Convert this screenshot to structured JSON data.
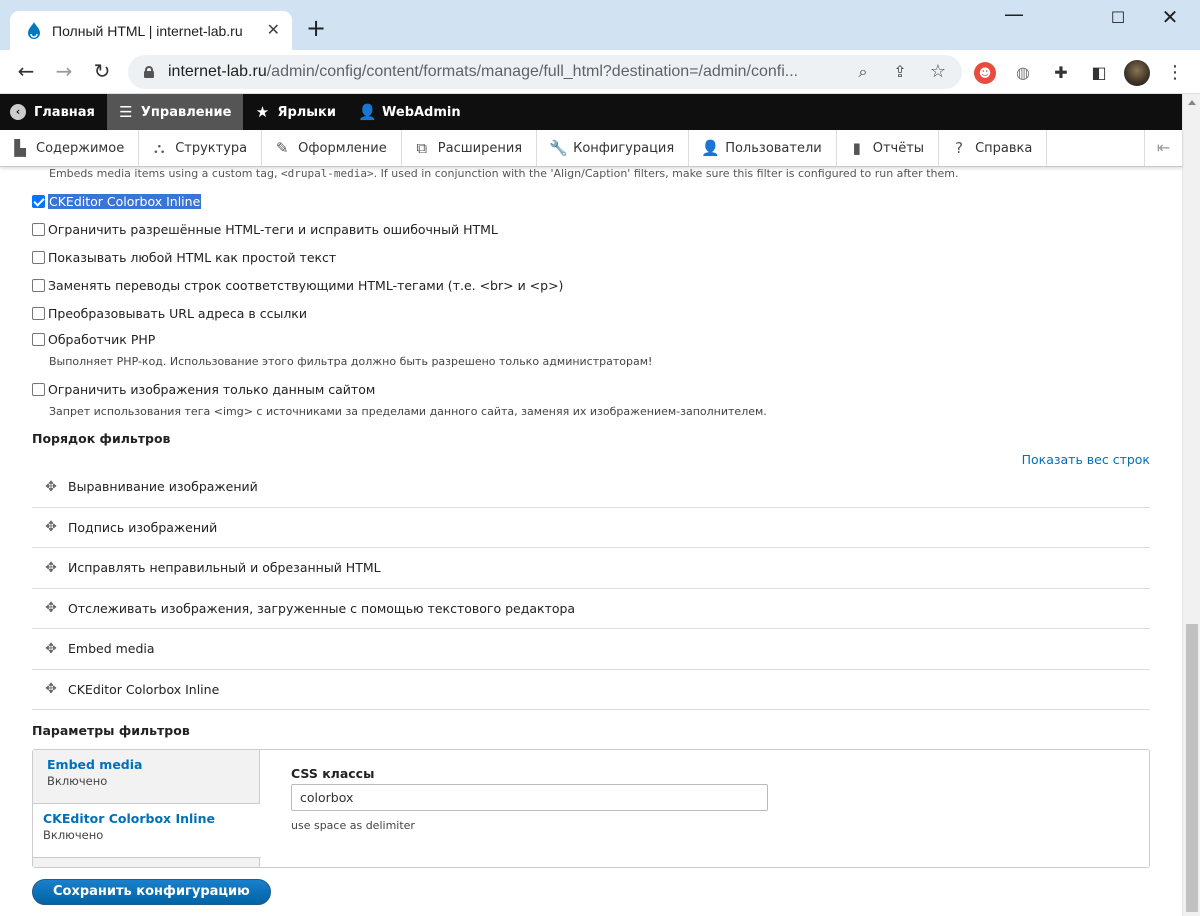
{
  "browser": {
    "tab_title": "Полный HTML | internet-lab.ru",
    "url_host": "internet-lab.ru",
    "url_path": "/admin/config/content/formats/manage/full_html?destination=/admin/confi...",
    "new_tab_glyph": "+",
    "close_glyph": "✕"
  },
  "drupal_toolbar": {
    "items": [
      {
        "label": "Главная",
        "icon": "drupal-home-icon"
      },
      {
        "label": "Управление",
        "icon": "menu-icon",
        "active": true
      },
      {
        "label": "Ярлыки",
        "icon": "star-icon"
      },
      {
        "label": "WebAdmin",
        "icon": "user-icon"
      }
    ]
  },
  "admin_tray": {
    "items": [
      {
        "label": "Содержимое",
        "icon": "content-icon"
      },
      {
        "label": "Структура",
        "icon": "structure-icon"
      },
      {
        "label": "Оформление",
        "icon": "appearance-icon"
      },
      {
        "label": "Расширения",
        "icon": "extend-icon"
      },
      {
        "label": "Конфигурация",
        "icon": "wrench-icon"
      },
      {
        "label": "Пользователи",
        "icon": "people-icon"
      },
      {
        "label": "Отчёты",
        "icon": "reports-icon"
      },
      {
        "label": "Справка",
        "icon": "help-icon"
      }
    ]
  },
  "filters": {
    "cut_description_prefix": "Embeds media items using a custom tag, ",
    "cut_description_code": "<drupal-media>",
    "cut_description_suffix": ". If used in conjunction with the 'Align/Caption' filters, make sure this filter is configured to run after them.",
    "items": [
      {
        "label": "CKEditor Colorbox Inline",
        "checked": true
      },
      {
        "label": "Ограничить разрешённые HTML-теги и исправить ошибочный HTML",
        "checked": false
      },
      {
        "label": "Показывать любой HTML как простой текст",
        "checked": false
      },
      {
        "label": "Заменять переводы строк соответствующими HTML-тегами (т.е. <br> и <p>)",
        "checked": false
      },
      {
        "label": "Преобразовывать URL адреса в ссылки",
        "checked": false
      },
      {
        "label": "Обработчик PHP",
        "checked": false,
        "description": "Выполняет PHP-код. Использование этого фильтра должно быть разрешено только администраторам!"
      },
      {
        "label": "Ограничить изображения только данным сайтом",
        "checked": false,
        "description": "Запрет использования тега <img> с источниками за пределами данного сайта, заменяя их изображением-заполнителем."
      }
    ]
  },
  "filter_order": {
    "title": "Порядок фильтров",
    "show_weights": "Показать вес строк",
    "rows": [
      "Выравнивание изображений",
      "Подпись изображений",
      "Исправлять неправильный и обрезанный HTML",
      "Отслеживать изображения, загруженные с помощью текстового редактора",
      "Embed media",
      "CKEditor Colorbox Inline"
    ]
  },
  "filter_settings": {
    "title": "Параметры фильтров",
    "tabs": [
      {
        "title": "Embed media",
        "summary": "Включено"
      },
      {
        "title": "CKEditor Colorbox Inline",
        "summary": "Включено"
      }
    ],
    "field_label": "CSS классы",
    "field_value": "colorbox",
    "field_description": "use space as delimiter"
  },
  "actions": {
    "save": "Сохранить конфигурацию"
  },
  "colors": {
    "link": "#0071b8",
    "toolbar_bg": "#0f0f0f",
    "selection": "#3875d7",
    "checkbox": "#0075ff"
  }
}
